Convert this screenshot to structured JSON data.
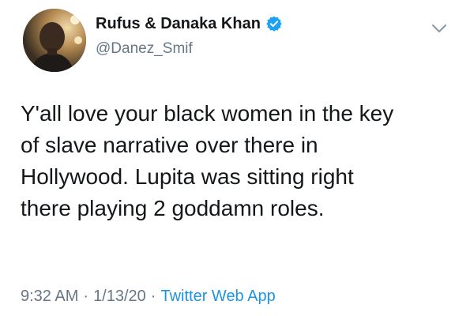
{
  "author": {
    "display_name": "Rufus & Danaka Khan",
    "handle": "@Danez_Smif",
    "verified": true,
    "avatar_icon": "user-avatar"
  },
  "tweet": {
    "lines": [
      "Y'all love your black women in the key",
      "of slave narrative over there in",
      "Hollywood. Lupita was sitting right",
      "there playing 2 goddamn roles."
    ]
  },
  "meta": {
    "time": "9:32 AM",
    "separator": "·",
    "date": "1/13/20",
    "source": "Twitter Web App"
  },
  "icons": {
    "verified": "verified-badge-icon",
    "menu": "chevron-down-icon"
  },
  "colors": {
    "text": "#14171a",
    "muted": "#657786",
    "link": "#1b95e0",
    "verified": "#1da1f2"
  }
}
